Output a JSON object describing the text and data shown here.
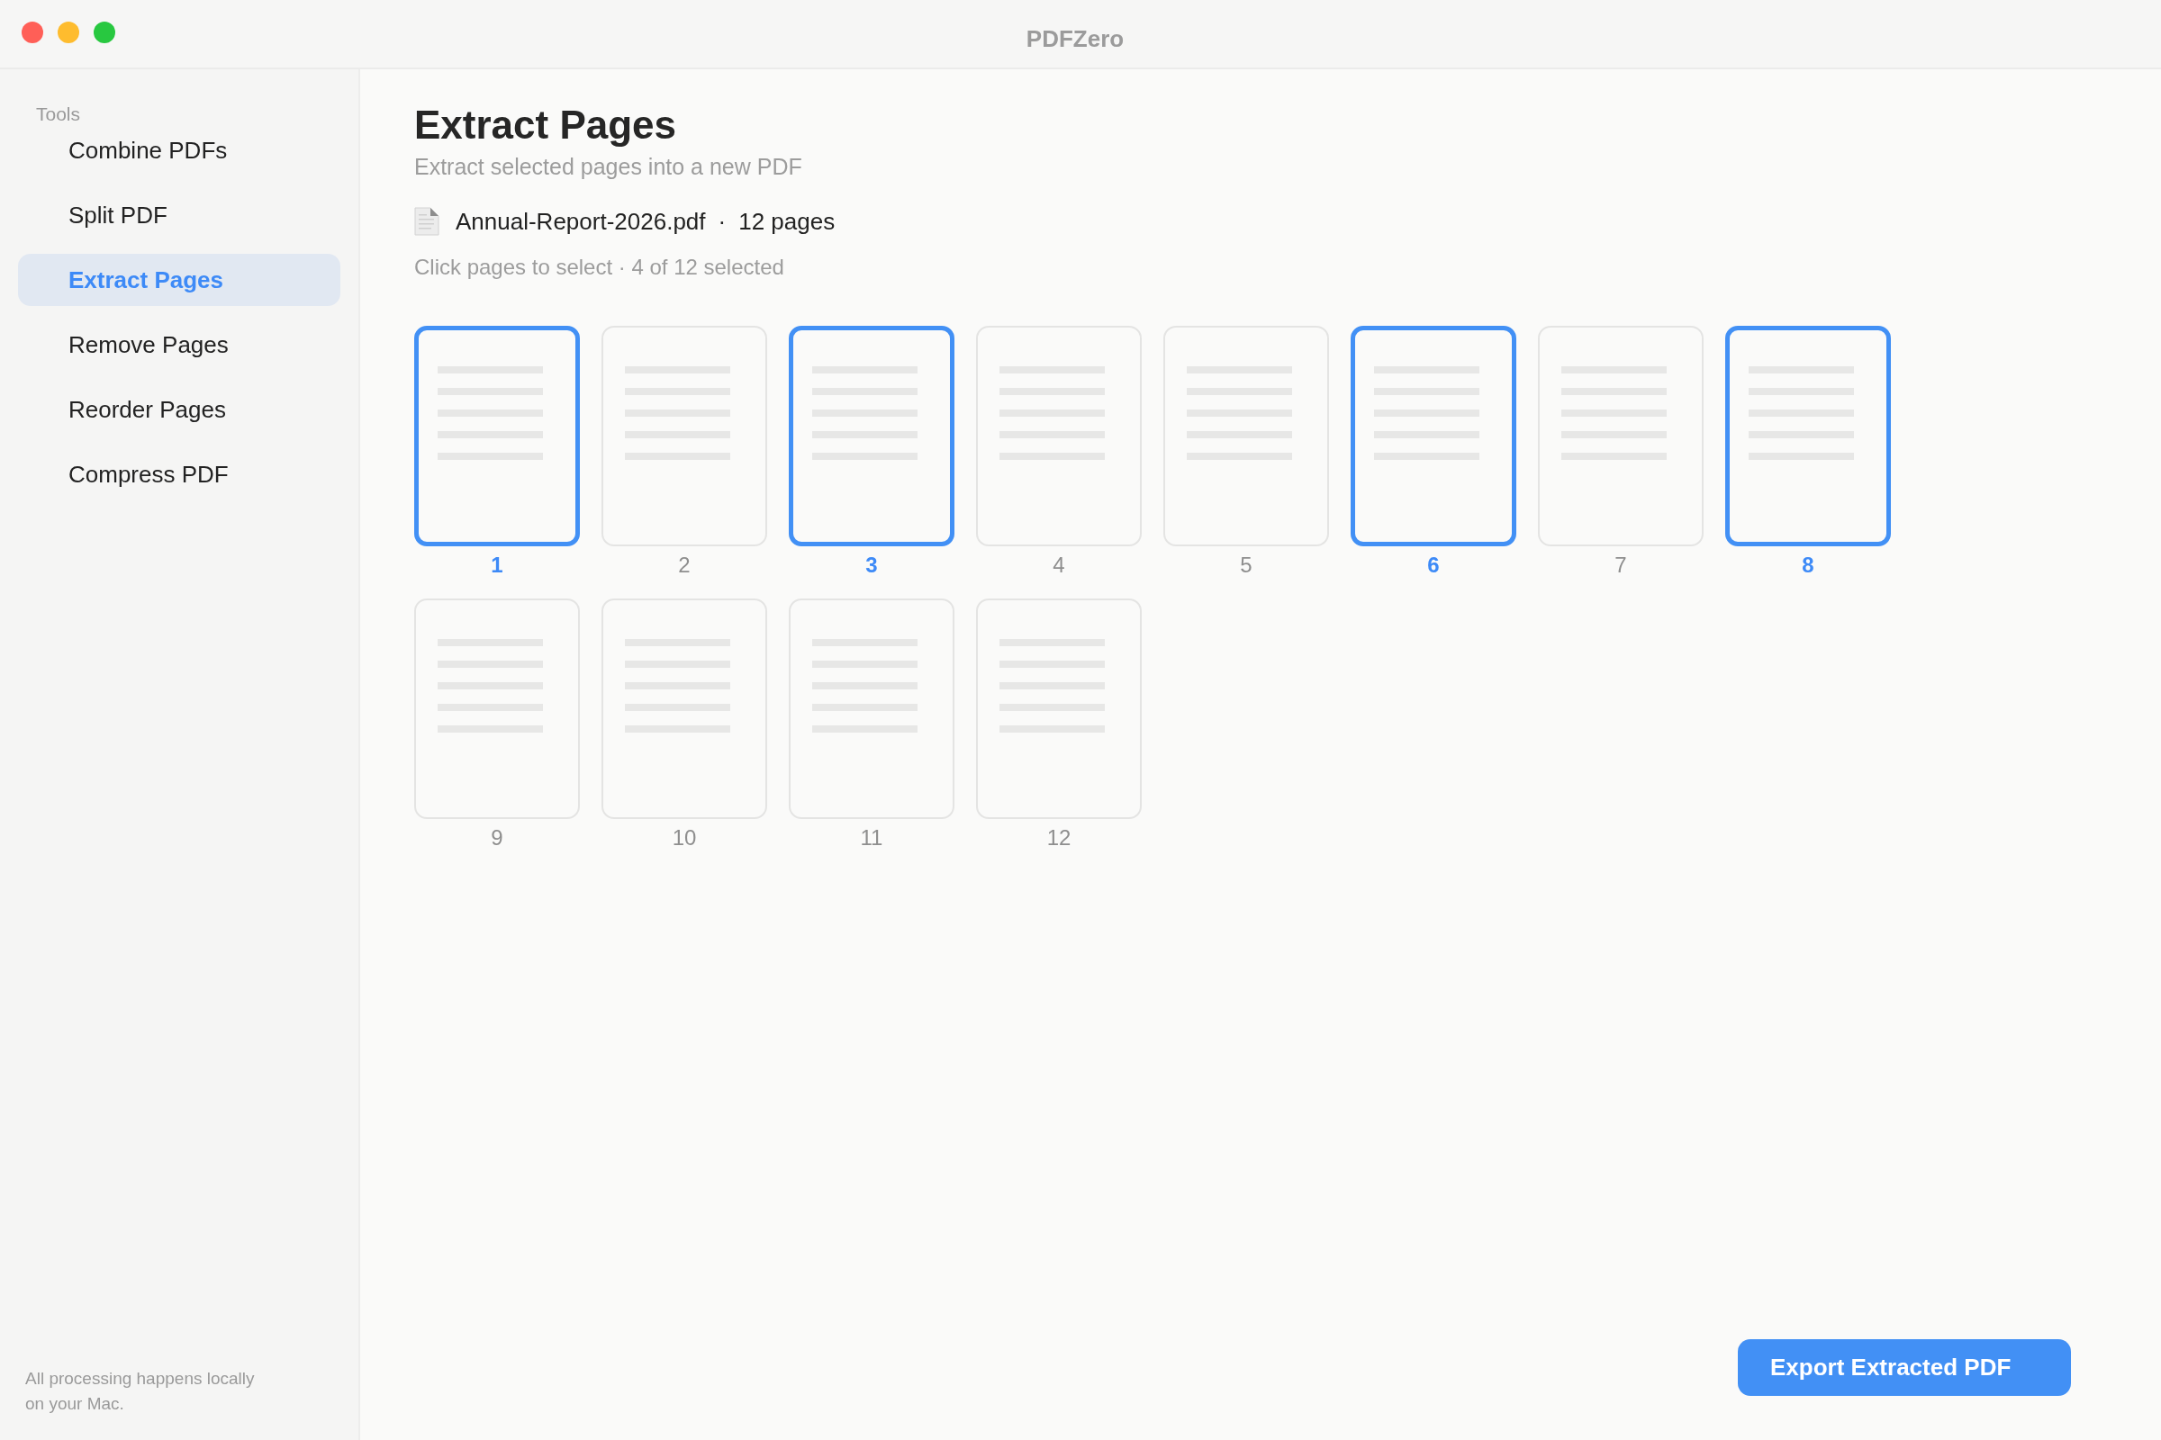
{
  "window": {
    "title": "PDFZero"
  },
  "sidebar": {
    "section_label": "Tools",
    "items": [
      {
        "label": "Combine PDFs",
        "selected": false
      },
      {
        "label": "Split PDF",
        "selected": false
      },
      {
        "label": "Extract Pages",
        "selected": true
      },
      {
        "label": "Remove Pages",
        "selected": false
      },
      {
        "label": "Reorder Pages",
        "selected": false
      },
      {
        "label": "Compress PDF",
        "selected": false
      }
    ],
    "footer": "All processing happens locally on your Mac."
  },
  "main": {
    "title": "Extract Pages",
    "subtitle": "Extract selected pages into a new PDF",
    "file": {
      "name": "Annual-Report-2026.pdf",
      "separator": "·",
      "page_count": "12 pages"
    },
    "hint": "Click pages to select · 4 of 12 selected",
    "pages": [
      {
        "label": "1",
        "selected": true
      },
      {
        "label": "2",
        "selected": false
      },
      {
        "label": "3",
        "selected": true
      },
      {
        "label": "4",
        "selected": false
      },
      {
        "label": "5",
        "selected": false
      },
      {
        "label": "6",
        "selected": true
      },
      {
        "label": "7",
        "selected": false
      },
      {
        "label": "8",
        "selected": true
      },
      {
        "label": "9",
        "selected": false
      },
      {
        "label": "10",
        "selected": false
      },
      {
        "label": "11",
        "selected": false
      },
      {
        "label": "12",
        "selected": false
      }
    ],
    "export_button": "Export Extracted PDF"
  }
}
